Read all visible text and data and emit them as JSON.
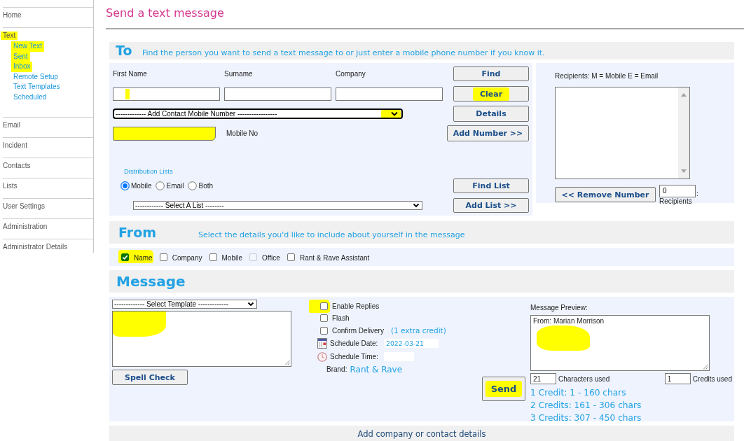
{
  "sidebar": {
    "items": [
      {
        "label": "Home",
        "highlighted": false
      },
      {
        "label": "Text",
        "highlighted": true,
        "children": [
          {
            "label": "New Text",
            "highlighted": true
          },
          {
            "label": "Sent",
            "highlighted": true
          },
          {
            "label": "Inbox",
            "highlighted": true
          },
          {
            "label": "Remote Setup",
            "highlighted": false
          },
          {
            "label": "Text Templates",
            "highlighted": false
          },
          {
            "label": "Scheduled",
            "highlighted": false
          }
        ]
      },
      {
        "label": "Email",
        "highlighted": false
      },
      {
        "label": "Incident",
        "highlighted": false
      },
      {
        "label": "Contacts",
        "highlighted": false
      },
      {
        "label": "Lists",
        "highlighted": false
      },
      {
        "label": "User Settings",
        "highlighted": false
      },
      {
        "label": "Administration",
        "highlighted": false
      },
      {
        "label": "Administrator Details",
        "highlighted": false
      }
    ]
  },
  "page_title": "Send a text message",
  "to_section": {
    "heading": "To",
    "subtitle": "Find the person you want to send a text message to or just enter a mobile phone number if you know it.",
    "search_fields": [
      {
        "label": "First Name",
        "highlighted": true
      },
      {
        "label": "Surname",
        "highlighted": false
      },
      {
        "label": "Company",
        "highlighted": false
      }
    ],
    "contact_select": {
      "value": "------------- Add Contact Mobile Number -----------------",
      "highlighted": true
    },
    "mobile_field": {
      "label": "Mobile No",
      "highlighted": true
    },
    "buttons": [
      {
        "label": "Find",
        "highlighted": false
      },
      {
        "label": "Clear",
        "highlighted": true
      },
      {
        "label": "Details",
        "highlighted": false
      },
      {
        "label": "Add Number >>",
        "highlighted": false
      }
    ],
    "distribution_lists": {
      "heading": "Distribution Lists",
      "options": [
        {
          "label": "Mobile",
          "selected": true
        },
        {
          "label": "Email",
          "selected": false
        },
        {
          "label": "Both",
          "selected": false
        }
      ],
      "list_select": {
        "value": "------------ Select A List --------"
      },
      "buttons": [
        {
          "label": "Find List"
        },
        {
          "label": "Add List >>"
        }
      ]
    }
  },
  "recipients": {
    "label": "Recipients: M = Mobile E = Email",
    "remove_button": "<< Remove Number",
    "count": "0",
    "count_separator": ":",
    "count_label": "Recipients"
  },
  "from_section": {
    "heading": "From",
    "subtitle": "Select the details you'd like to include about yourself in the message",
    "options": [
      {
        "label": "Name",
        "checked": true,
        "disabled": false,
        "highlighted": true
      },
      {
        "label": "Company",
        "checked": false,
        "disabled": false,
        "highlighted": false
      },
      {
        "label": "Mobile",
        "checked": false,
        "disabled": false,
        "highlighted": false
      },
      {
        "label": "Office",
        "checked": false,
        "disabled": true,
        "highlighted": false
      },
      {
        "label": "Rant & Rave Assistant",
        "checked": false,
        "disabled": false,
        "highlighted": false
      }
    ]
  },
  "message_section": {
    "heading": "Message",
    "template_select": {
      "value": "------------- Select Template -------------"
    },
    "body_field": {
      "highlighted": true
    },
    "spell_check_button": "Spell Check",
    "options": [
      {
        "label": "Enable Replies",
        "checked": false,
        "highlighted": true
      },
      {
        "label": "Flash",
        "checked": false,
        "highlighted": false
      },
      {
        "label": "Confirm Delivery",
        "checked": false,
        "highlighted": false,
        "note": "(1 extra credit)"
      }
    ],
    "schedule_date": {
      "label": "Schedule Date:",
      "value": "2022-03-21"
    },
    "schedule_time": {
      "label": "Schedule Time:"
    },
    "brand": {
      "label": "Brand:",
      "value": "Rant & Rave"
    },
    "send_button": {
      "label": "Send",
      "highlighted": true
    },
    "preview": {
      "label": "Message Preview:",
      "value": "From: Marian Morrison",
      "highlighted": true
    },
    "characters": {
      "value": "21",
      "label": "Characters used"
    },
    "credits": {
      "value": "1",
      "label": "Credits used"
    },
    "credit_tiers": [
      "1 Credit: 1 - 160 chars",
      "2 Credits: 161 - 306 chars",
      "3 Credits: 307 - 450 chars"
    ]
  },
  "footer": {
    "label": "Add company or contact details"
  }
}
